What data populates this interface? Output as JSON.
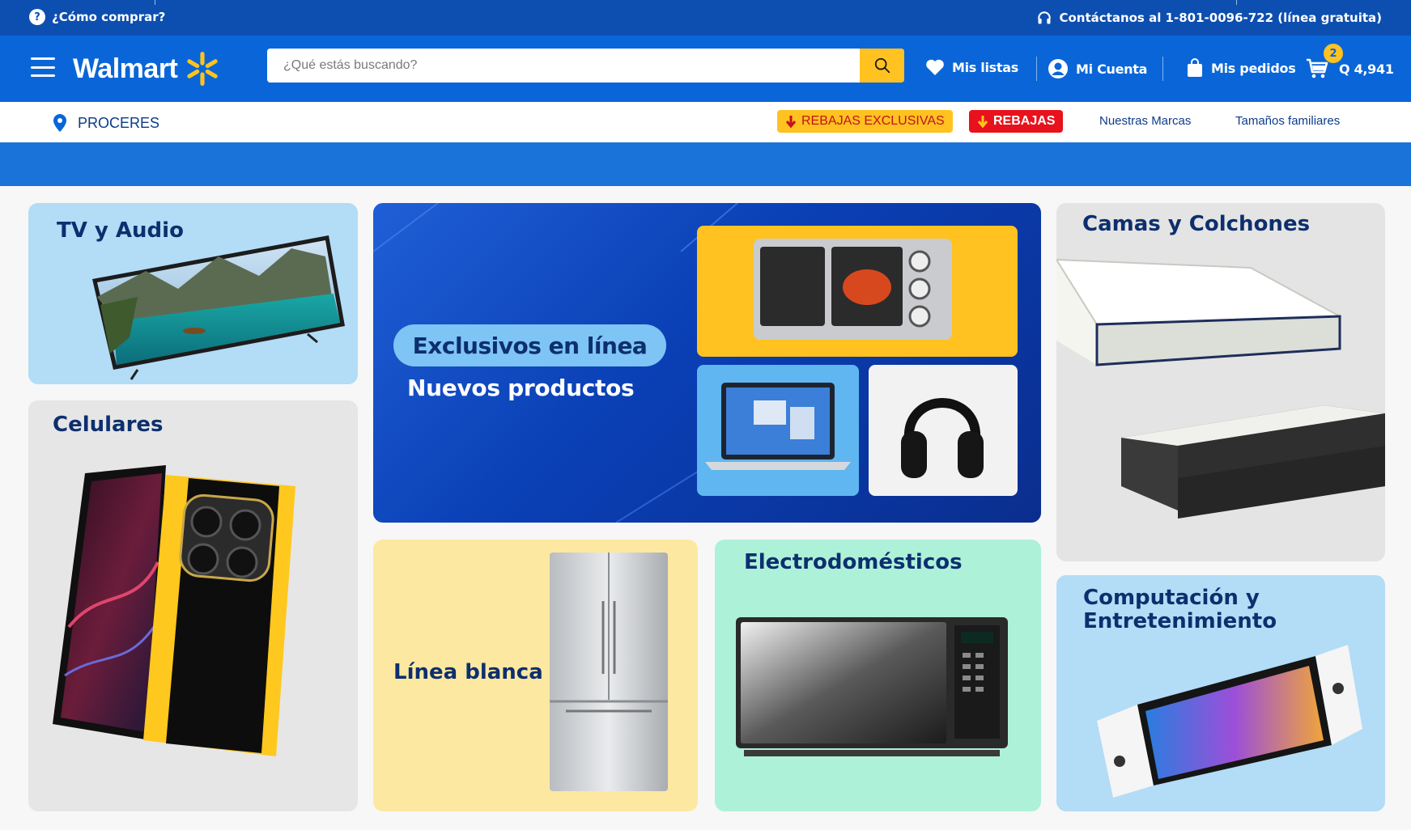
{
  "topbar": {
    "help_text": "¿Cómo comprar?",
    "contact_text": "Contáctanos al 1-801-0096-722 (línea gratuita)"
  },
  "header": {
    "brand": "Walmart",
    "search_placeholder": "¿Qué estás buscando?",
    "lists_label": "Mis listas",
    "account_label": "Mi Cuenta",
    "orders_label": "Mis pedidos",
    "cart_count": "2",
    "cart_total": "Q 4,941"
  },
  "subnav": {
    "location": "PROCERES",
    "promo_exclusive": "REBAJAS EXCLUSIVAS",
    "promo_sales": "REBAJAS",
    "brands_link": "Nuestras Marcas",
    "family_link": "Tamaños familiares"
  },
  "cards": {
    "tv": "TV y Audio",
    "cel": "Celulares",
    "hero_pill": "Exclusivos en línea",
    "hero_sub": "Nuevos productos",
    "linea": "Línea blanca",
    "electro": "Electrodomésticos",
    "camas": "Camas y Colchones",
    "comp_line1": "Computación y",
    "comp_line2": "Entretenimiento"
  },
  "colors": {
    "brand_blue": "#0a66d8",
    "top_blue": "#0d4fb0",
    "accent_yellow": "#ffc220",
    "sale_red": "#e8121c",
    "title_navy": "#0d2f6e"
  },
  "icons": [
    "help-icon",
    "headset-icon",
    "menu-icon",
    "spark-logo-icon",
    "search-icon",
    "heart-icon",
    "account-icon",
    "bag-icon",
    "cart-icon",
    "location-pin-icon",
    "arrow-down-icon"
  ]
}
